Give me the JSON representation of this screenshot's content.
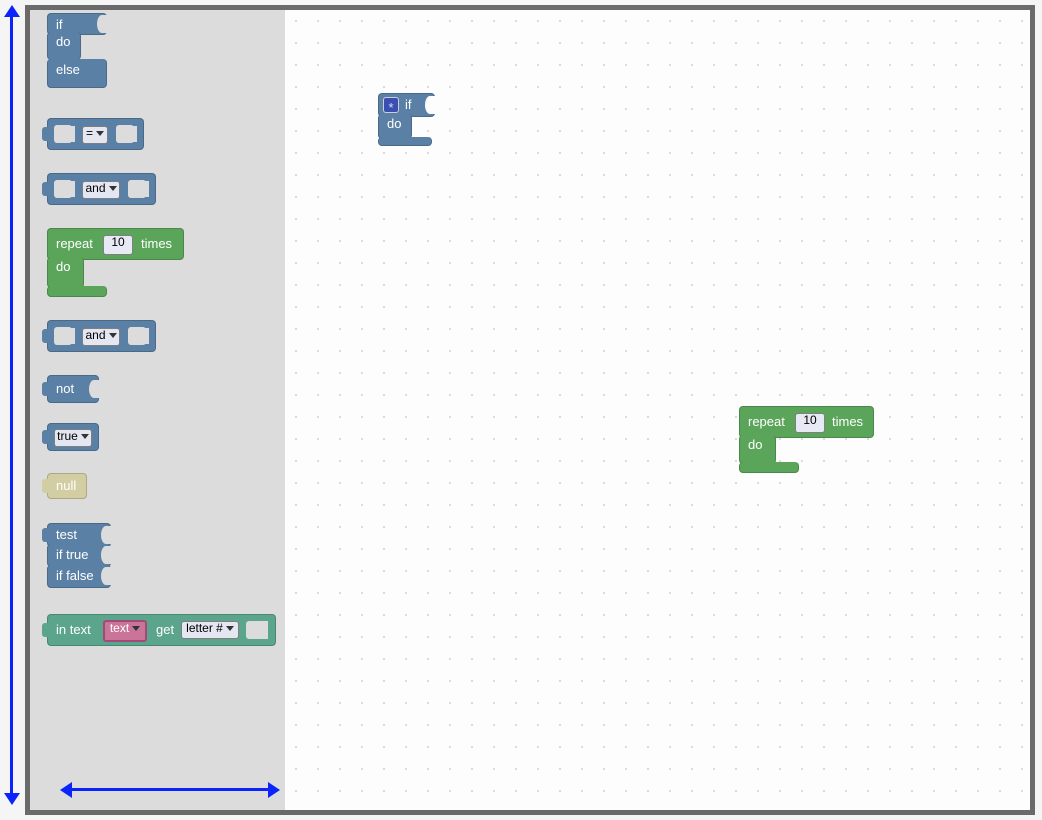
{
  "toolbox": {
    "if_do_else": {
      "if": "if",
      "do": "do",
      "else": "else"
    },
    "compare_op": "=",
    "and_block_1": "and",
    "repeat_block": {
      "repeat": "repeat",
      "count": "10",
      "times": "times",
      "do": "do"
    },
    "and_block_2": "and",
    "not_block": "not",
    "true_block": "true",
    "null_block": "null",
    "test_block": {
      "test": "test",
      "if_true": "if true",
      "if_false": "if false"
    },
    "text_block": {
      "in_text": "in text",
      "text_field": "text",
      "get": "get",
      "letter": "letter #"
    }
  },
  "workspace": {
    "if_block": {
      "if": "if",
      "do": "do"
    },
    "repeat_block": {
      "repeat": "repeat",
      "count": "10",
      "times": "times",
      "do": "do"
    }
  }
}
